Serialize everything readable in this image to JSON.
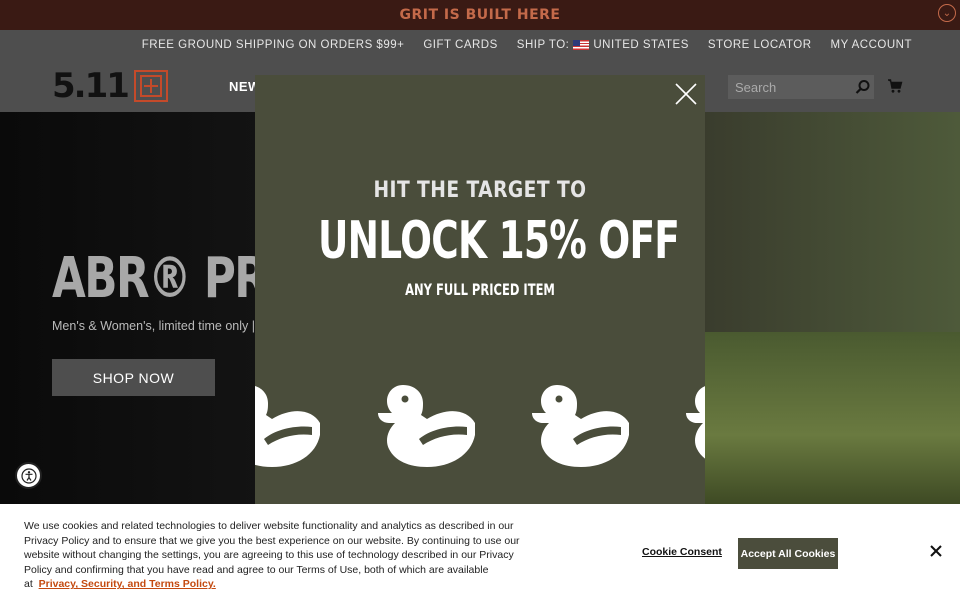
{
  "promo": {
    "text": "GRIT IS BUILT HERE"
  },
  "utility": {
    "shipping": "FREE GROUND SHIPPING ON ORDERS $99+",
    "gift_cards": "GIFT CARDS",
    "ship_to_label": "SHIP TO:",
    "country": "UNITED STATES",
    "store_locator": "STORE LOCATOR",
    "account": "MY ACCOUNT"
  },
  "header": {
    "logo_text": "5.11",
    "nav_first": "NEW",
    "search_placeholder": "Search"
  },
  "hero": {
    "title": "ABR® PRO PA",
    "subtitle": "Men's & Women's, limited time only | I",
    "cta": "SHOP NOW"
  },
  "modal": {
    "kicker": "HIT THE TARGET TO",
    "headline": "UNLOCK 15% OFF",
    "subline": "ANY FULL PRICED ITEM",
    "icon": "duck-target-icon"
  },
  "cookie": {
    "text": "We use cookies and related technologies to deliver website functionality and analytics as described in our Privacy Policy and to ensure that we give you the best experience on our website. By continuing to use our website without changing the settings, you are agreeing to this use of technology described in our Privacy Policy and confirming that you have read and agree to our Terms of Use, both of which are available at",
    "link": "Privacy, Security, and Terms Policy.",
    "consent": "Cookie Consent",
    "accept": "Accept All Cookies"
  },
  "colors": {
    "promo_bg": "#3a1a14",
    "brand_orange": "#c44a2a",
    "header_bg": "#4e4e4e",
    "modal_bg": "#4a4d3b"
  }
}
